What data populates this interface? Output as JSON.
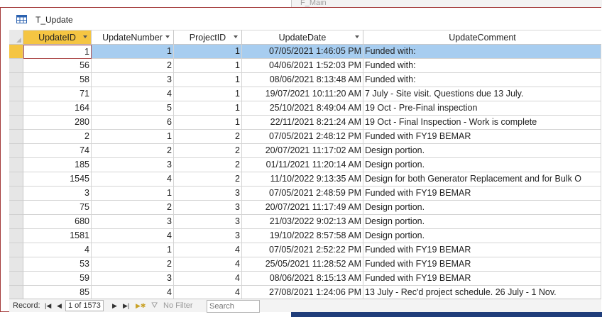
{
  "background": {
    "window_label": "F_Main"
  },
  "window": {
    "title": "T_Update",
    "icon": "table-icon"
  },
  "columns": [
    {
      "key": "id",
      "label": "UpdateID"
    },
    {
      "key": "num",
      "label": "UpdateNumber"
    },
    {
      "key": "proj",
      "label": "ProjectID"
    },
    {
      "key": "date",
      "label": "UpdateDate"
    },
    {
      "key": "comment",
      "label": "UpdateComment"
    }
  ],
  "rows": [
    [
      "1",
      "1",
      "1",
      "07/05/2021 1:46:05 PM",
      "Funded with:"
    ],
    [
      "56",
      "2",
      "1",
      "04/06/2021 1:52:03 PM",
      "Funded with:"
    ],
    [
      "58",
      "3",
      "1",
      "08/06/2021 8:13:48 AM",
      "Funded with:"
    ],
    [
      "71",
      "4",
      "1",
      "19/07/2021 10:11:20 AM",
      "7 July - Site visit.  Questions due 13 July."
    ],
    [
      "164",
      "5",
      "1",
      "25/10/2021 8:49:04 AM",
      "19 Oct - Pre-Final inspection"
    ],
    [
      "280",
      "6",
      "1",
      "22/11/2021 8:21:24 AM",
      "19 Oct - Final Inspection - Work is complete"
    ],
    [
      "2",
      "1",
      "2",
      "07/05/2021 2:48:12 PM",
      "Funded with FY19 BEMAR"
    ],
    [
      "74",
      "2",
      "2",
      "20/07/2021 11:17:02 AM",
      " Design portion."
    ],
    [
      "185",
      "3",
      "2",
      "01/11/2021 11:20:14 AM",
      "Design portion."
    ],
    [
      "1545",
      "4",
      "2",
      "11/10/2022 9:13:35 AM",
      "Design for both Generator Replacement and for Bulk O"
    ],
    [
      "3",
      "1",
      "3",
      "07/05/2021 2:48:59 PM",
      "Funded with FY19 BEMAR"
    ],
    [
      "75",
      "2",
      "3",
      "20/07/2021 11:17:49 AM",
      "Design portion."
    ],
    [
      "680",
      "3",
      "3",
      "21/03/2022 9:02:13 AM",
      "Design portion."
    ],
    [
      "1581",
      "4",
      "3",
      "19/10/2022 8:57:58 AM",
      "Design portion."
    ],
    [
      "4",
      "1",
      "4",
      "07/05/2021 2:52:22 PM",
      "Funded with FY19 BEMAR"
    ],
    [
      "53",
      "2",
      "4",
      "25/05/2021 11:28:52 AM",
      "Funded with FY19 BEMAR"
    ],
    [
      "59",
      "3",
      "4",
      "08/06/2021 8:15:13 AM",
      "Funded with FY19 BEMAR"
    ],
    [
      "85",
      "4",
      "4",
      "27/08/2021 1:24:06 PM",
      "13 July - Rec'd project schedule.  26 July - 1 Nov."
    ]
  ],
  "navigation": {
    "record_label": "Record:",
    "position": "1 of 1573",
    "filter_label": "No Filter",
    "search_placeholder": "Search"
  },
  "colors": {
    "selected_header": "#f5c542",
    "selected_row": "#a7cdf0",
    "window_border": "#a33a3a"
  }
}
